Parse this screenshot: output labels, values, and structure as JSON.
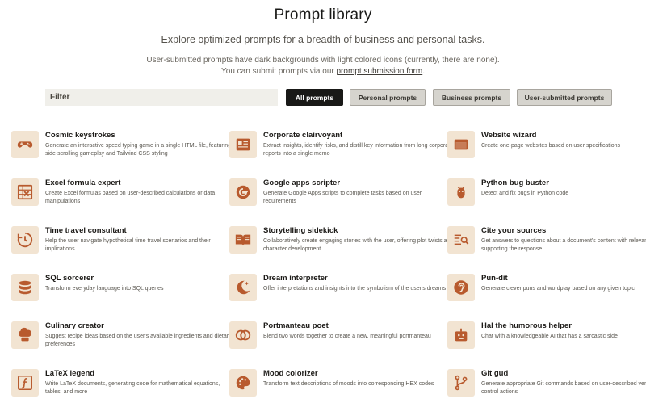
{
  "header": {
    "title": "Prompt library",
    "subtitle": "Explore optimized prompts for a breadth of business and personal tasks.",
    "note_line1": "User-submitted prompts have dark backgrounds with light colored icons (currently, there are none).",
    "note_line2_prefix": "You can submit prompts via our ",
    "note_link": "prompt submission form",
    "note_line2_suffix": "."
  },
  "filter": {
    "placeholder": "Filter"
  },
  "tabs": [
    {
      "label": "All prompts",
      "active": true
    },
    {
      "label": "Personal prompts",
      "active": false
    },
    {
      "label": "Business prompts",
      "active": false
    },
    {
      "label": "User-submitted prompts",
      "active": false
    }
  ],
  "colors": {
    "icon_bg": "#f2e4d2",
    "icon_fg": "#b85a2e",
    "active_tab": "#191917"
  },
  "cards": [
    {
      "title": "Cosmic keystrokes",
      "desc": "Generate an interactive speed typing game in a single HTML file, featuring side-scrolling gameplay and Tailwind CSS styling",
      "icon": "gamepad-icon"
    },
    {
      "title": "Corporate clairvoyant",
      "desc": "Extract insights, identify risks, and distill key information from long corporate reports into a single memo",
      "icon": "report-icon"
    },
    {
      "title": "Website wizard",
      "desc": "Create one-page websites based on user specifications",
      "icon": "browser-window-icon"
    },
    {
      "title": "Excel formula expert",
      "desc": "Create Excel formulas based on user-described calculations or data manipulations",
      "icon": "spreadsheet-icon"
    },
    {
      "title": "Google apps scripter",
      "desc": "Generate Google Apps scripts to complete tasks based on user requirements",
      "icon": "google-logo-icon"
    },
    {
      "title": "Python bug buster",
      "desc": "Detect and fix bugs in Python code",
      "icon": "bug-icon"
    },
    {
      "title": "Time travel consultant",
      "desc": "Help the user navigate hypothetical time travel scenarios and their implications",
      "icon": "clock-arrow-icon"
    },
    {
      "title": "Storytelling sidekick",
      "desc": "Collaboratively create engaging stories with the user, offering plot twists and character development",
      "icon": "open-book-icon"
    },
    {
      "title": "Cite your sources",
      "desc": "Get answers to questions about a document's content with relevant citations supporting the response",
      "icon": "document-search-icon"
    },
    {
      "title": "SQL sorcerer",
      "desc": "Transform everyday language into SQL queries",
      "icon": "database-icon"
    },
    {
      "title": "Dream interpreter",
      "desc": "Offer interpretations and insights into the symbolism of the user's dreams",
      "icon": "moon-stars-icon"
    },
    {
      "title": "Pun-dit",
      "desc": "Generate clever puns and wordplay based on any given topic",
      "icon": "ear-icon"
    },
    {
      "title": "Culinary creator",
      "desc": "Suggest recipe ideas based on the user's available ingredients and dietary preferences",
      "icon": "chef-hat-icon"
    },
    {
      "title": "Portmanteau poet",
      "desc": "Blend two words together to create a new, meaningful portmanteau",
      "icon": "overlapping-circles-icon"
    },
    {
      "title": "Hal the humorous helper",
      "desc": "Chat with a knowledgeable AI that has a sarcastic side",
      "icon": "robot-icon"
    },
    {
      "title": "LaTeX legend",
      "desc": "Write LaTeX documents, generating code for mathematical equations, tables, and more",
      "icon": "function-icon"
    },
    {
      "title": "Mood colorizer",
      "desc": "Transform text descriptions of moods into corresponding HEX codes",
      "icon": "palette-icon"
    },
    {
      "title": "Git gud",
      "desc": "Generate appropriate Git commands based on user-described version control actions",
      "icon": "git-branch-icon"
    }
  ]
}
